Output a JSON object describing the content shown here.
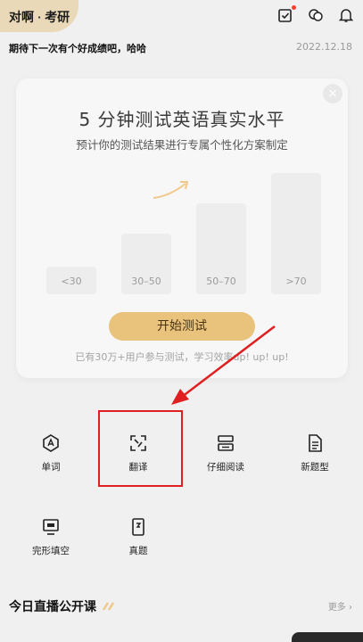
{
  "header": {
    "brand": "对啊",
    "separator": "·",
    "category": "考研",
    "icons": [
      "checkbox-icon",
      "chat-bubbles-icon",
      "bell-icon"
    ],
    "accent": "#e6c68a"
  },
  "notice": {
    "text": "期待下一次有个好成绩吧，哈哈",
    "date": "2022.12.18"
  },
  "popup": {
    "close": "×",
    "title": "5 分钟测试英语真实水平",
    "subtitle": "预计你的测试结果进行专属个性化方案制定",
    "levels": [
      {
        "label": "<30",
        "level": 0.22
      },
      {
        "label": "30–50",
        "level": 0.48
      },
      {
        "label": "50–70",
        "level": 0.72
      },
      {
        "label": ">70",
        "level": 0.96
      }
    ],
    "start_button": "开始测试",
    "footer": "已有30万+用户参与测试，学习效率up! up! up!"
  },
  "menu": [
    {
      "label": "单词",
      "icon": "letter-a-icon"
    },
    {
      "label": "翻译",
      "icon": "translate-icon"
    },
    {
      "label": "仔细阅读",
      "icon": "reading-icon"
    },
    {
      "label": "新题型",
      "icon": "document-icon"
    },
    {
      "label": "完形填空",
      "icon": "cloze-icon"
    },
    {
      "label": "真题",
      "icon": "exam-icon"
    }
  ],
  "live": {
    "title": "今日直播公开课",
    "more": "更多"
  },
  "colors": {
    "highlight": "#e02020",
    "button": "#e9c27c"
  }
}
